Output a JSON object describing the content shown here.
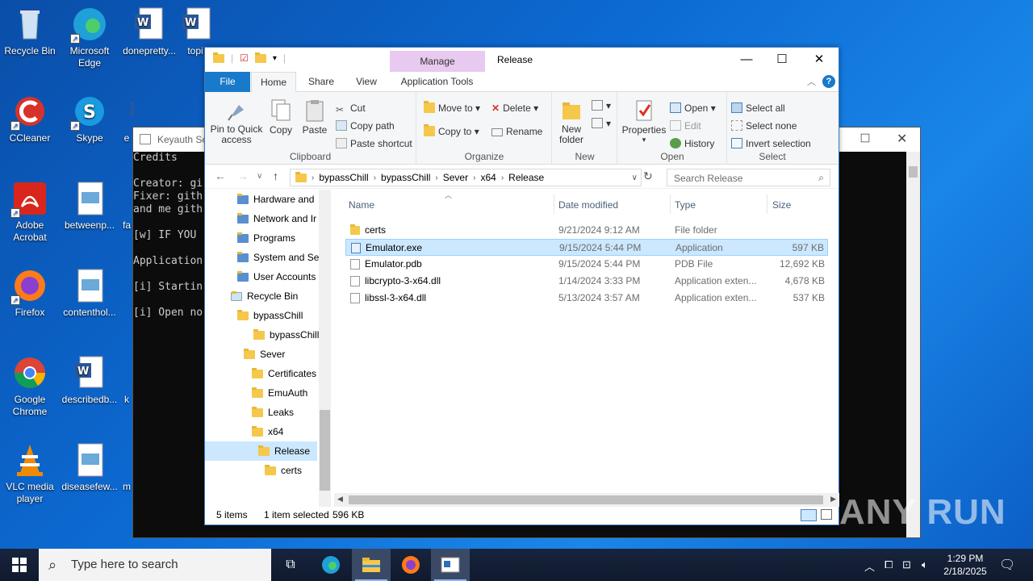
{
  "desktop": {
    "icons": [
      {
        "label": "Recycle Bin"
      },
      {
        "label": "Microsoft Edge"
      },
      {
        "label": "donepretty..."
      },
      {
        "label": "topi"
      },
      {
        "label": "CCleaner"
      },
      {
        "label": "Skype"
      },
      {
        "label": "e"
      },
      {
        "label": "Adobe Acrobat"
      },
      {
        "label": "betweenp..."
      },
      {
        "label": "fa"
      },
      {
        "label": "Firefox"
      },
      {
        "label": "contenthol..."
      },
      {
        "label": "Google Chrome"
      },
      {
        "label": "describedb..."
      },
      {
        "label": "k"
      },
      {
        "label": "VLC media player"
      },
      {
        "label": "diseasefew..."
      },
      {
        "label": "m"
      }
    ]
  },
  "console": {
    "title": "Keyauth Ser",
    "lines": [
      "Credits",
      "",
      "Creator: gi",
      "Fixer: gith",
      "and me gith",
      "",
      "[w] IF YOU",
      "",
      "Application",
      "",
      "[i] Startin",
      "",
      "[i] Open no"
    ]
  },
  "explorer": {
    "title": "Release",
    "manage_tab": "Manage",
    "tabs": {
      "file": "File",
      "home": "Home",
      "share": "Share",
      "view": "View",
      "app_tools": "Application Tools"
    },
    "ribbon": {
      "clipboard": {
        "label": "Clipboard",
        "pin": "Pin to Quick access",
        "copy": "Copy",
        "paste": "Paste",
        "cut": "Cut",
        "copy_path": "Copy path",
        "paste_shortcut": "Paste shortcut"
      },
      "organize": {
        "label": "Organize",
        "move_to": "Move to",
        "copy_to": "Copy to",
        "delete": "Delete",
        "rename": "Rename"
      },
      "new": {
        "label": "New",
        "new_folder": "New folder"
      },
      "open": {
        "label": "Open",
        "properties": "Properties",
        "open": "Open",
        "edit": "Edit",
        "history": "History"
      },
      "select": {
        "label": "Select",
        "select_all": "Select all",
        "select_none": "Select none",
        "invert": "Invert selection"
      }
    },
    "address": [
      "bypassChill",
      "bypassChill",
      "Sever",
      "x64",
      "Release"
    ],
    "search_placeholder": "Search Release",
    "nav": [
      {
        "label": "Hardware and",
        "indent": 1
      },
      {
        "label": "Network and Ir",
        "indent": 1
      },
      {
        "label": "Programs",
        "indent": 1
      },
      {
        "label": "System and Sec",
        "indent": 1
      },
      {
        "label": "User Accounts",
        "indent": 1
      },
      {
        "label": "Recycle Bin",
        "indent": 0
      },
      {
        "label": "bypassChill",
        "indent": 0
      },
      {
        "label": "bypassChill",
        "indent": 1
      },
      {
        "label": "Sever",
        "indent": 2
      },
      {
        "label": "Certificates",
        "indent": 3
      },
      {
        "label": "EmuAuth",
        "indent": 3
      },
      {
        "label": "Leaks",
        "indent": 3
      },
      {
        "label": "x64",
        "indent": 3
      },
      {
        "label": "Release",
        "indent": 4
      },
      {
        "label": "certs",
        "indent": 5
      }
    ],
    "columns": {
      "name": "Name",
      "date": "Date modified",
      "type": "Type",
      "size": "Size"
    },
    "files": [
      {
        "name": "certs",
        "date": "9/21/2024 9:12 AM",
        "type": "File folder",
        "size": ""
      },
      {
        "name": "Emulator.exe",
        "date": "9/15/2024 5:44 PM",
        "type": "Application",
        "size": "597 KB"
      },
      {
        "name": "Emulator.pdb",
        "date": "9/15/2024 5:44 PM",
        "type": "PDB File",
        "size": "12,692 KB"
      },
      {
        "name": "libcrypto-3-x64.dll",
        "date": "1/14/2024 3:33 PM",
        "type": "Application exten...",
        "size": "4,678 KB"
      },
      {
        "name": "libssl-3-x64.dll",
        "date": "5/13/2024 3:57 AM",
        "type": "Application exten...",
        "size": "537 KB"
      }
    ],
    "status": {
      "items": "5 items",
      "selected": "1 item selected",
      "size": "596 KB"
    }
  },
  "taskbar": {
    "search_placeholder": "Type here to search",
    "time": "1:29 PM",
    "date": "2/18/2025"
  },
  "watermark": "ANY RUN"
}
